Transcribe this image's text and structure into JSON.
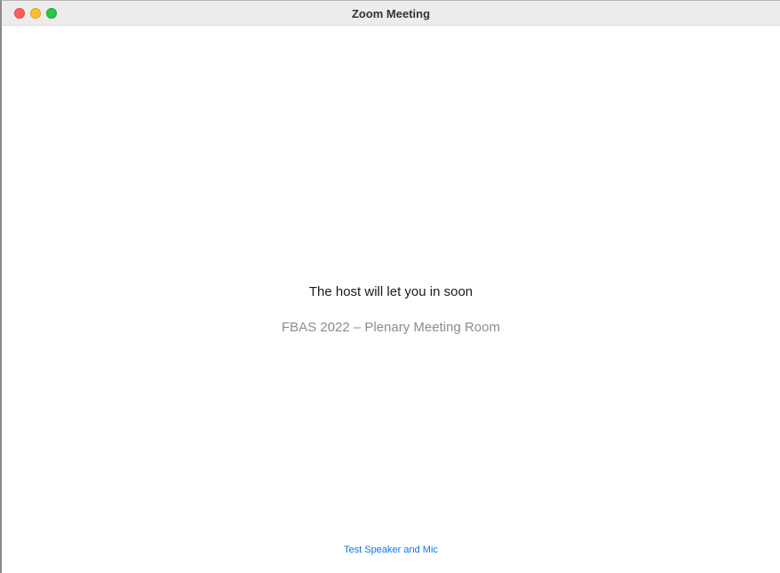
{
  "window": {
    "title": "Zoom Meeting"
  },
  "waiting_room": {
    "message": "The host will let you in soon",
    "meeting_name": "FBAS 2022 – Plenary Meeting Room",
    "test_audio_link": "Test Speaker and Mic"
  },
  "colors": {
    "link": "#0e72ed",
    "secondary_text": "#8c8c8c",
    "close": "#ff5f57",
    "minimize": "#febc2e",
    "zoom": "#28c840"
  }
}
